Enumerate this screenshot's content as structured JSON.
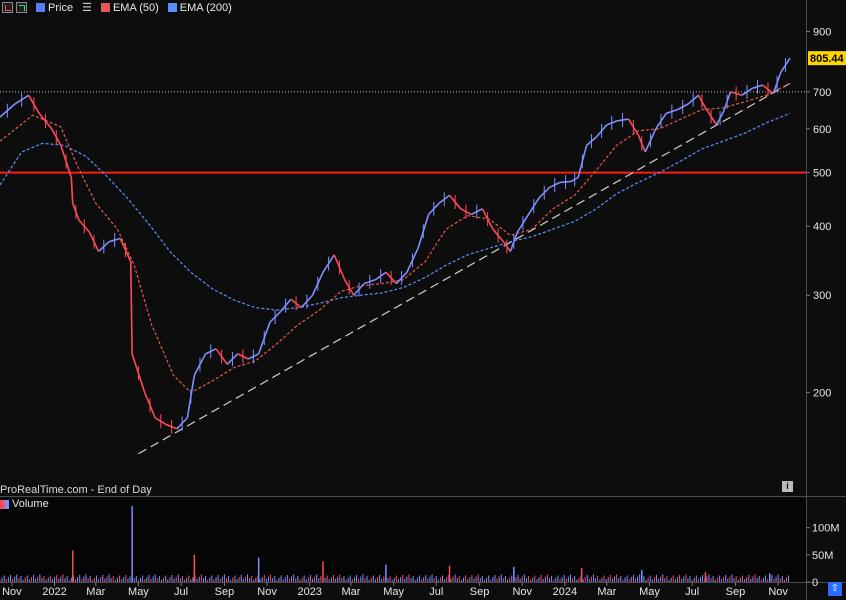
{
  "toolbar": {
    "items": [
      {
        "label": "Price",
        "color": "#5b7cff"
      },
      {
        "label": "EMA (50)",
        "color": "#e05a5a"
      },
      {
        "label": "EMA (200)",
        "color": "#5b8fff"
      }
    ]
  },
  "watermark": "ProRealTime.com - End of Day",
  "volume_label": "Volume",
  "last_price_label": "805.44",
  "colors": {
    "background": "#0d0d0d",
    "up": "#7f8fff",
    "down": "#ff4a5a",
    "ema50": "#e05a4a",
    "ema200": "#5b8fff",
    "resistance": "#ff1a1a",
    "trendline": "#cfcfcf",
    "last_price_bg": "#ffd400"
  },
  "chart_data": [
    {
      "type": "line",
      "yscale": "log",
      "ylim": [
        130,
        960
      ],
      "y_ticks": [
        200,
        300,
        400,
        500,
        600,
        700,
        900
      ],
      "y_tick_labels": [
        "200",
        "300",
        "400",
        "500",
        "600",
        "700",
        "900"
      ],
      "x_ticks": [
        "2021-11-01",
        "2022-01-01",
        "2022-03-01",
        "2022-05-01",
        "2022-07-01",
        "2022-09-01",
        "2022-11-01",
        "2023-01-01",
        "2023-03-01",
        "2023-05-01",
        "2023-07-01",
        "2023-09-01",
        "2023-11-01",
        "2024-01-01",
        "2024-03-01",
        "2024-05-01",
        "2024-07-01",
        "2024-09-01",
        "2024-11-01"
      ],
      "x_tick_labels": [
        "Nov",
        "2022",
        "Mar",
        "May",
        "Jul",
        "Sep",
        "Nov",
        "2023",
        "Mar",
        "May",
        "Jul",
        "Sep",
        "Nov",
        "2024",
        "Mar",
        "May",
        "Jul",
        "Sep",
        "Nov"
      ],
      "xlim": [
        "2021-10-15",
        "2024-11-18"
      ],
      "series": [
        {
          "role": "price",
          "points": [
            [
              "2021-10-15",
              630
            ],
            [
              "2021-11-05",
              665
            ],
            [
              "2021-11-25",
              690
            ],
            [
              "2021-12-10",
              640
            ],
            [
              "2021-12-28",
              600
            ],
            [
              "2022-01-10",
              560
            ],
            [
              "2022-01-25",
              490
            ],
            [
              "2022-01-27",
              440
            ],
            [
              "2022-02-05",
              410
            ],
            [
              "2022-02-20",
              390
            ],
            [
              "2022-03-05",
              360
            ],
            [
              "2022-03-20",
              375
            ],
            [
              "2022-04-05",
              380
            ],
            [
              "2022-04-20",
              345
            ],
            [
              "2022-04-22",
              235
            ],
            [
              "2022-05-10",
              200
            ],
            [
              "2022-05-25",
              180
            ],
            [
              "2022-06-10",
              175
            ],
            [
              "2022-06-25",
              172
            ],
            [
              "2022-07-10",
              180
            ],
            [
              "2022-07-20",
              215
            ],
            [
              "2022-08-05",
              235
            ],
            [
              "2022-08-20",
              240
            ],
            [
              "2022-09-05",
              225
            ],
            [
              "2022-09-20",
              235
            ],
            [
              "2022-10-05",
              230
            ],
            [
              "2022-10-20",
              235
            ],
            [
              "2022-11-05",
              268
            ],
            [
              "2022-11-20",
              280
            ],
            [
              "2022-12-05",
              295
            ],
            [
              "2022-12-20",
              285
            ],
            [
              "2023-01-05",
              300
            ],
            [
              "2023-01-20",
              330
            ],
            [
              "2023-02-05",
              355
            ],
            [
              "2023-02-20",
              320
            ],
            [
              "2023-03-05",
              300
            ],
            [
              "2023-03-20",
              315
            ],
            [
              "2023-04-05",
              320
            ],
            [
              "2023-04-20",
              330
            ],
            [
              "2023-05-05",
              315
            ],
            [
              "2023-05-20",
              330
            ],
            [
              "2023-06-05",
              365
            ],
            [
              "2023-06-20",
              420
            ],
            [
              "2023-07-05",
              440
            ],
            [
              "2023-07-20",
              455
            ],
            [
              "2023-08-05",
              430
            ],
            [
              "2023-08-20",
              420
            ],
            [
              "2023-09-05",
              430
            ],
            [
              "2023-09-20",
              395
            ],
            [
              "2023-10-05",
              375
            ],
            [
              "2023-10-15",
              360
            ],
            [
              "2023-10-25",
              390
            ],
            [
              "2023-11-10",
              420
            ],
            [
              "2023-11-25",
              450
            ],
            [
              "2023-12-10",
              470
            ],
            [
              "2023-12-25",
              480
            ],
            [
              "2024-01-10",
              482
            ],
            [
              "2024-01-20",
              490
            ],
            [
              "2024-02-01",
              560
            ],
            [
              "2024-02-15",
              580
            ],
            [
              "2024-03-01",
              610
            ],
            [
              "2024-03-15",
              620
            ],
            [
              "2024-04-01",
              625
            ],
            [
              "2024-04-15",
              585
            ],
            [
              "2024-04-25",
              545
            ],
            [
              "2024-05-10",
              600
            ],
            [
              "2024-05-25",
              640
            ],
            [
              "2024-06-10",
              650
            ],
            [
              "2024-06-25",
              665
            ],
            [
              "2024-07-10",
              690
            ],
            [
              "2024-07-20",
              655
            ],
            [
              "2024-08-05",
              610
            ],
            [
              "2024-08-15",
              645
            ],
            [
              "2024-08-25",
              700
            ],
            [
              "2024-09-10",
              690
            ],
            [
              "2024-09-25",
              710
            ],
            [
              "2024-10-10",
              720
            ],
            [
              "2024-10-25",
              695
            ],
            [
              "2024-11-05",
              760
            ],
            [
              "2024-11-18",
              805.44
            ]
          ]
        },
        {
          "role": "ema50",
          "points": [
            [
              "2021-10-15",
              570
            ],
            [
              "2021-12-01",
              635
            ],
            [
              "2022-01-10",
              605
            ],
            [
              "2022-02-01",
              520
            ],
            [
              "2022-03-01",
              440
            ],
            [
              "2022-04-01",
              395
            ],
            [
              "2022-04-25",
              340
            ],
            [
              "2022-05-20",
              265
            ],
            [
              "2022-06-20",
              215
            ],
            [
              "2022-07-15",
              200
            ],
            [
              "2022-08-15",
              210
            ],
            [
              "2022-09-15",
              222
            ],
            [
              "2022-10-15",
              228
            ],
            [
              "2022-11-15",
              245
            ],
            [
              "2022-12-15",
              265
            ],
            [
              "2023-01-15",
              282
            ],
            [
              "2023-02-15",
              305
            ],
            [
              "2023-03-15",
              312
            ],
            [
              "2023-04-15",
              315
            ],
            [
              "2023-05-15",
              320
            ],
            [
              "2023-06-15",
              345
            ],
            [
              "2023-07-15",
              395
            ],
            [
              "2023-08-15",
              418
            ],
            [
              "2023-09-15",
              412
            ],
            [
              "2023-10-15",
              385
            ],
            [
              "2023-11-15",
              395
            ],
            [
              "2023-12-15",
              430
            ],
            [
              "2024-01-15",
              455
            ],
            [
              "2024-02-15",
              505
            ],
            [
              "2024-03-15",
              560
            ],
            [
              "2024-04-15",
              595
            ],
            [
              "2024-05-15",
              600
            ],
            [
              "2024-06-15",
              625
            ],
            [
              "2024-07-15",
              650
            ],
            [
              "2024-08-15",
              655
            ],
            [
              "2024-09-15",
              672
            ],
            [
              "2024-10-15",
              690
            ],
            [
              "2024-11-18",
              725
            ]
          ]
        },
        {
          "role": "ema200",
          "points": [
            [
              "2021-10-15",
              475
            ],
            [
              "2021-11-15",
              545
            ],
            [
              "2021-12-15",
              565
            ],
            [
              "2022-01-15",
              560
            ],
            [
              "2022-02-15",
              535
            ],
            [
              "2022-03-15",
              495
            ],
            [
              "2022-04-15",
              450
            ],
            [
              "2022-05-15",
              405
            ],
            [
              "2022-06-15",
              360
            ],
            [
              "2022-07-15",
              330
            ],
            [
              "2022-08-15",
              308
            ],
            [
              "2022-09-15",
              294
            ],
            [
              "2022-10-15",
              285
            ],
            [
              "2022-11-15",
              282
            ],
            [
              "2022-12-15",
              285
            ],
            [
              "2023-01-15",
              290
            ],
            [
              "2023-02-15",
              297
            ],
            [
              "2023-03-15",
              300
            ],
            [
              "2023-04-15",
              303
            ],
            [
              "2023-05-15",
              310
            ],
            [
              "2023-06-15",
              323
            ],
            [
              "2023-07-15",
              340
            ],
            [
              "2023-08-15",
              355
            ],
            [
              "2023-09-15",
              365
            ],
            [
              "2023-10-15",
              375
            ],
            [
              "2023-11-15",
              383
            ],
            [
              "2023-12-15",
              395
            ],
            [
              "2024-01-15",
              408
            ],
            [
              "2024-02-15",
              430
            ],
            [
              "2024-03-15",
              458
            ],
            [
              "2024-04-15",
              480
            ],
            [
              "2024-05-15",
              500
            ],
            [
              "2024-06-15",
              525
            ],
            [
              "2024-07-15",
              552
            ],
            [
              "2024-08-15",
              570
            ],
            [
              "2024-09-15",
              590
            ],
            [
              "2024-10-15",
              615
            ],
            [
              "2024-11-18",
              640
            ]
          ]
        }
      ],
      "resistance_level": 500,
      "reference_level": 700,
      "trendline": [
        [
          "2022-05-01",
          155
        ],
        [
          "2024-11-18",
          725
        ]
      ]
    },
    {
      "type": "bar",
      "role": "volume",
      "ylim": [
        0,
        140
      ],
      "y_ticks": [
        0,
        50,
        100
      ],
      "y_tick_labels": [
        "0",
        "50M",
        "100M"
      ],
      "spikes": [
        {
          "date": "2022-01-27",
          "value": 58
        },
        {
          "date": "2022-04-22",
          "value": 140
        },
        {
          "date": "2022-07-20",
          "value": 50
        },
        {
          "date": "2022-10-20",
          "value": 45
        },
        {
          "date": "2023-01-20",
          "value": 38
        },
        {
          "date": "2023-04-20",
          "value": 32
        },
        {
          "date": "2023-07-20",
          "value": 30
        },
        {
          "date": "2023-10-20",
          "value": 28
        },
        {
          "date": "2024-01-25",
          "value": 26
        },
        {
          "date": "2024-04-20",
          "value": 22
        },
        {
          "date": "2024-07-20",
          "value": 18
        },
        {
          "date": "2024-10-20",
          "value": 16
        }
      ]
    }
  ]
}
